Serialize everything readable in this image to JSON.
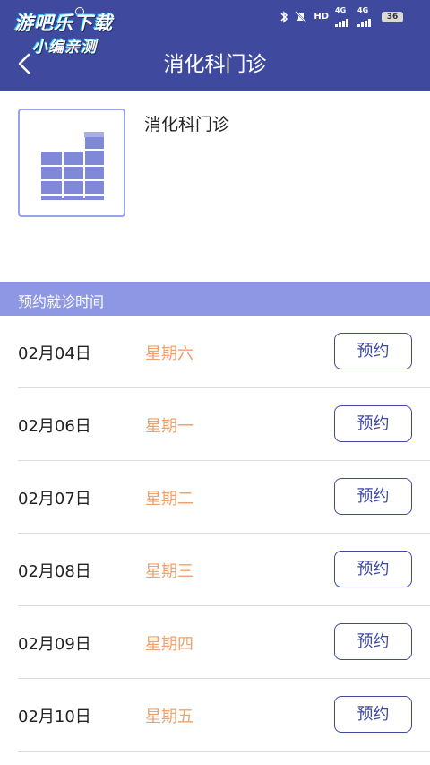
{
  "watermark": {
    "line1": "游吧乐下载",
    "line2": "小编亲测"
  },
  "status_bar": {
    "hd": "HD",
    "net1": "4G",
    "net2": "4G",
    "battery": "36"
  },
  "header": {
    "title": "消化科门诊"
  },
  "department": {
    "name": "消化科门诊"
  },
  "section": {
    "label": "预约就诊时间"
  },
  "colors": {
    "header": "#3f4a9e",
    "section": "#8e97e3",
    "weekday": "#f0a16c"
  },
  "schedule": [
    {
      "date": "02月04日",
      "weekday": "星期六",
      "action": "预约"
    },
    {
      "date": "02月06日",
      "weekday": "星期一",
      "action": "预约"
    },
    {
      "date": "02月07日",
      "weekday": "星期二",
      "action": "预约"
    },
    {
      "date": "02月08日",
      "weekday": "星期三",
      "action": "预约"
    },
    {
      "date": "02月09日",
      "weekday": "星期四",
      "action": "预约"
    },
    {
      "date": "02月10日",
      "weekday": "星期五",
      "action": "预约"
    }
  ]
}
